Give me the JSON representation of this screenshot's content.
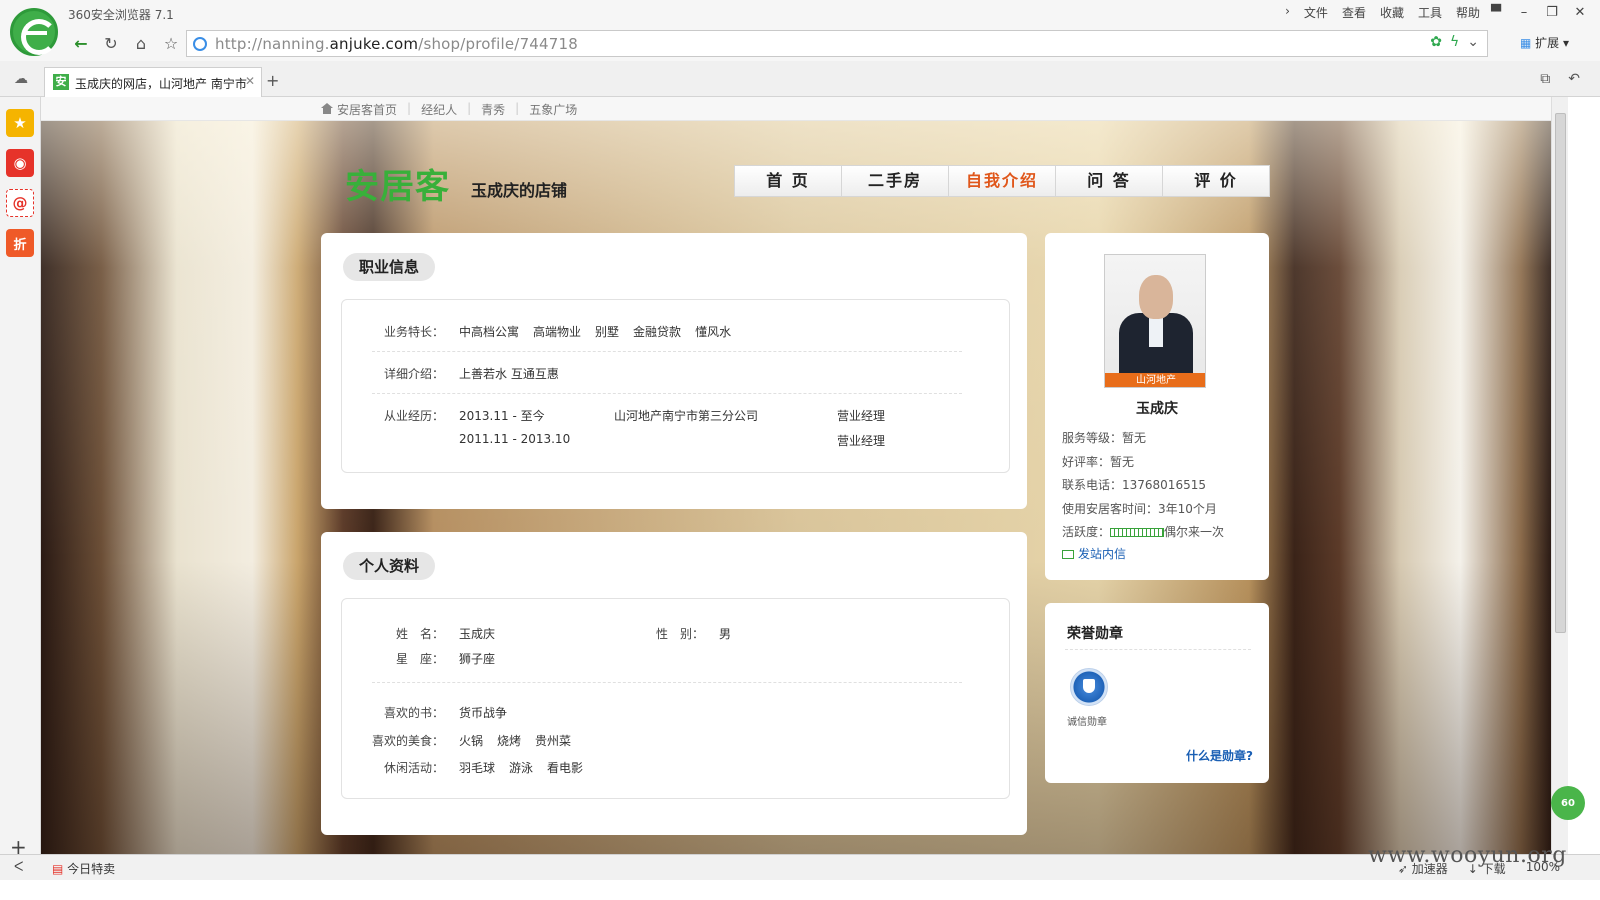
{
  "browser": {
    "title": "360安全浏览器 7.1",
    "menu": [
      "文件",
      "查看",
      "收藏",
      "工具",
      "帮助"
    ],
    "url_prefix": "http://nanning.",
    "url_domain": "anjuke.com",
    "url_path": "/shop/profile/744718",
    "extension_label": "扩展",
    "tab_title": "玉成庆的网店，山河地产 南宁市",
    "status_today": "今日特卖",
    "status_items": [
      "加速器",
      "下载",
      "100%"
    ],
    "watermark": "www.wooyun.org",
    "badge": "60"
  },
  "topnav": {
    "items": [
      "安居客首页",
      "经纪人",
      "青秀",
      "五象广场"
    ]
  },
  "header": {
    "brand": "安居客",
    "shop_name": "玉成庆的店铺"
  },
  "mainnav": [
    "首 页",
    "二手房",
    "自我介绍",
    "问 答",
    "评 价"
  ],
  "career": {
    "title": "职业信息",
    "specialty_label": "业务特长：",
    "specialties": [
      "中高档公寓",
      "高端物业",
      "别墅",
      "金融贷款",
      "懂风水"
    ],
    "detail_label": "详细介绍：",
    "detail": "上善若水 互通互惠",
    "experience_label": "从业经历：",
    "experience": [
      {
        "period": "2013.11 - 至今",
        "company": "山河地产南宁市第三分公司",
        "position": "营业经理"
      },
      {
        "period": "2011.11 - 2013.10",
        "company": "",
        "position": "营业经理"
      }
    ]
  },
  "personal": {
    "title": "个人资料",
    "name_label": "姓　名：",
    "name": "玉成庆",
    "gender_label": "性　别：",
    "gender": "男",
    "zodiac_label": "星　座：",
    "zodiac": "狮子座",
    "books_label": "喜欢的书：",
    "books": [
      "货币战争"
    ],
    "food_label": "喜欢的美食：",
    "food": [
      "火锅",
      "烧烤",
      "贵州菜"
    ],
    "leisure_label": "休闲活动：",
    "leisure": [
      "羽毛球",
      "游泳",
      "看电影"
    ]
  },
  "profile": {
    "photo_logo": "山河地产",
    "name": "玉成庆",
    "service_level": "服务等级：暂无",
    "rating": "好评率：暂无",
    "phone": "联系电话：13768016515",
    "usage_time": "使用安居客时间：3年10个月",
    "activity_label": "活跃度：",
    "activity_text": "偶尔来一次",
    "message_link": "发站内信"
  },
  "honors": {
    "title": "荣誉勋章",
    "medal_label": "诚信勋章",
    "what_is": "什么是勋章?"
  }
}
